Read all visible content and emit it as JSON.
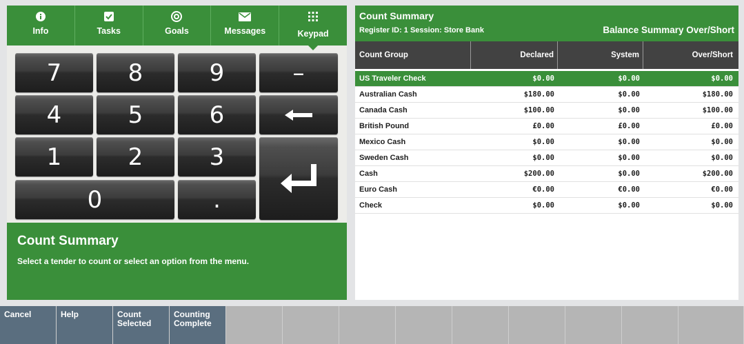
{
  "nav": {
    "tabs": [
      {
        "label": "Info",
        "icon": "info-icon"
      },
      {
        "label": "Tasks",
        "icon": "check-icon"
      },
      {
        "label": "Goals",
        "icon": "target-icon"
      },
      {
        "label": "Messages",
        "icon": "envelope-icon"
      },
      {
        "label": "Keypad",
        "icon": "grid-icon"
      }
    ],
    "active": "Keypad"
  },
  "keypad": {
    "k7": "7",
    "k8": "8",
    "k9": "9",
    "minus": "–",
    "k4": "4",
    "k5": "5",
    "k6": "6",
    "back": "⟵",
    "k1": "1",
    "k2": "2",
    "k3": "3",
    "k0": "0",
    "dot": ".",
    "enter": "↵"
  },
  "message": {
    "title": "Count Summary",
    "body": "Select a tender to count or select an option from the menu."
  },
  "summary": {
    "title": "Count Summary",
    "subtitle": "Register ID: 1 Session: Store Bank",
    "right_title": "Balance Summary Over/Short",
    "columns": {
      "group": "Count Group",
      "declared": "Declared",
      "system": "System",
      "over_short": "Over/Short"
    },
    "rows": [
      {
        "group": "US Traveler Check",
        "declared": "$0.00",
        "system": "$0.00",
        "over_short": "$0.00"
      },
      {
        "group": "Australian Cash",
        "declared": "$180.00",
        "system": "$0.00",
        "over_short": "$180.00"
      },
      {
        "group": "Canada Cash",
        "declared": "$100.00",
        "system": "$0.00",
        "over_short": "$100.00"
      },
      {
        "group": "British Pound",
        "declared": "£0.00",
        "system": "£0.00",
        "over_short": "£0.00"
      },
      {
        "group": "Mexico Cash",
        "declared": "$0.00",
        "system": "$0.00",
        "over_short": "$0.00"
      },
      {
        "group": "Sweden Cash",
        "declared": "$0.00",
        "system": "$0.00",
        "over_short": "$0.00"
      },
      {
        "group": "Cash",
        "declared": "$200.00",
        "system": "$0.00",
        "over_short": "$200.00"
      },
      {
        "group": "Euro Cash",
        "declared": "€0.00",
        "system": "€0.00",
        "over_short": "€0.00"
      },
      {
        "group": "Check",
        "declared": "$0.00",
        "system": "$0.00",
        "over_short": "$0.00"
      }
    ],
    "selected_row": "US Traveler Check"
  },
  "footer": {
    "buttons": [
      {
        "label": "Cancel"
      },
      {
        "label": "Help"
      },
      {
        "label": "Count\nSelected"
      },
      {
        "label": "Counting\nComplete"
      }
    ],
    "empty_slots": 9
  },
  "colors": {
    "accent_green": "#3a8f3a",
    "header_dark": "#424242",
    "footer_active": "#5a6e7f",
    "footer_inactive": "#b5b5b5"
  }
}
